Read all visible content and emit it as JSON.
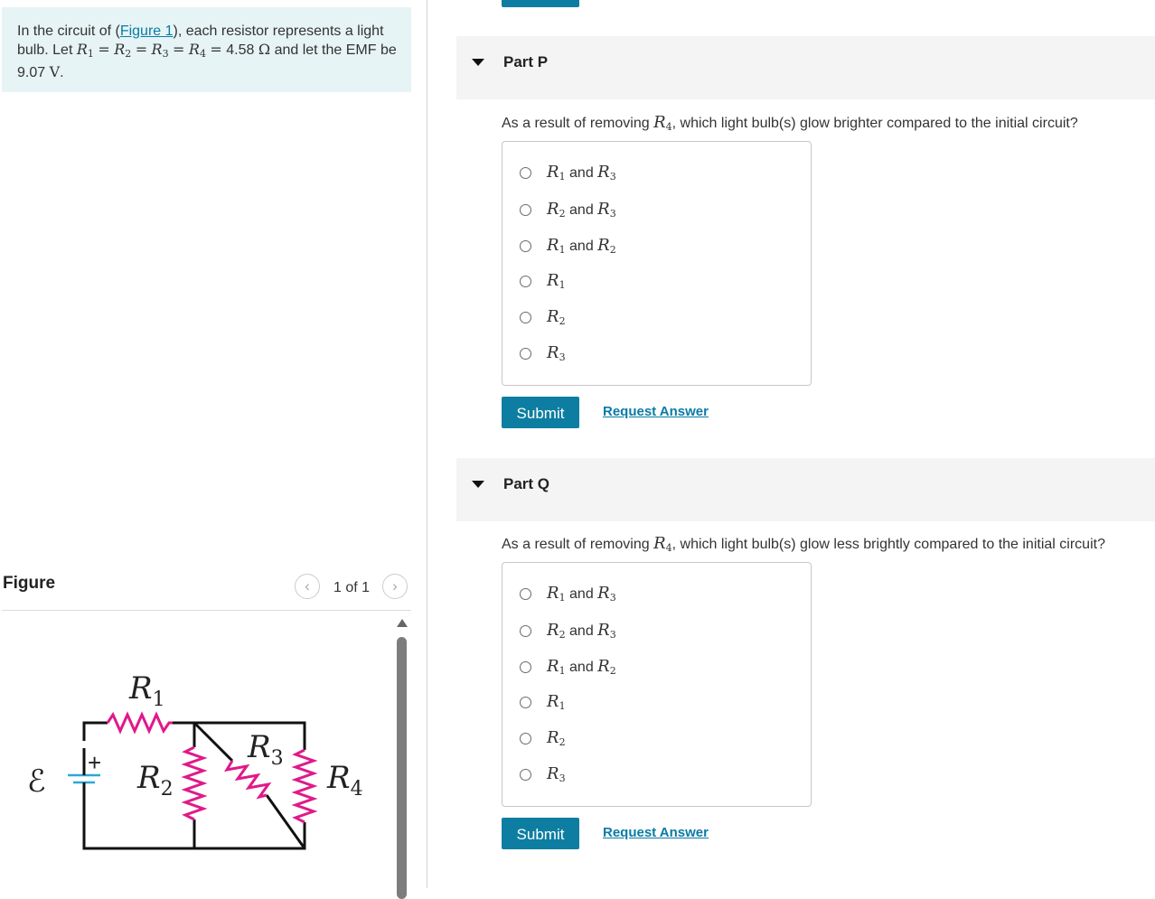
{
  "intro": {
    "p1": "In the circuit of (",
    "link": "Figure 1",
    "p2": "), each resistor represents a light bulb. Let ",
    "r1": "R",
    "r2": "R",
    "r3": "R",
    "r4": "R",
    "s1": "1",
    "s2": "2",
    "s3": "3",
    "s4": "4",
    "eq": "=",
    "value": "4.58",
    "ohm": "Ω",
    "p3": " and let the EMF be ",
    "emf": "9.07",
    "volt": "V",
    "p4": "."
  },
  "figure": {
    "title": "Figure",
    "pager": "1 of 1",
    "prev_icon": "chevron-left-icon",
    "next_icon": "chevron-right-icon",
    "labels": {
      "R": "R",
      "s1": "1",
      "s2": "2",
      "s3": "3",
      "s4": "4",
      "emf": "ℰ",
      "plus": "+"
    },
    "resistor_color": "#e0198a",
    "battery_color": "#2aa8d8"
  },
  "parts": [
    {
      "header": "Part P",
      "question_pre": "As a result of removing ",
      "question_var": "R",
      "question_sub": "4",
      "question_post": ", which light bulb(s) glow brighter compared to the initial circuit?",
      "choices": [
        {
          "a": "R",
          "as": "1",
          "and": "and",
          "b": "R",
          "bs": "3"
        },
        {
          "a": "R",
          "as": "2",
          "and": "and",
          "b": "R",
          "bs": "3"
        },
        {
          "a": "R",
          "as": "1",
          "and": "and",
          "b": "R",
          "bs": "2"
        },
        {
          "a": "R",
          "as": "1"
        },
        {
          "a": "R",
          "as": "2"
        },
        {
          "a": "R",
          "as": "3"
        }
      ],
      "submit": "Submit",
      "request": "Request Answer"
    },
    {
      "header": "Part Q",
      "question_pre": "As a result of removing ",
      "question_var": "R",
      "question_sub": "4",
      "question_post": ", which light bulb(s) glow less brightly compared to the initial circuit?",
      "choices": [
        {
          "a": "R",
          "as": "1",
          "and": "and",
          "b": "R",
          "bs": "3"
        },
        {
          "a": "R",
          "as": "2",
          "and": "and",
          "b": "R",
          "bs": "3"
        },
        {
          "a": "R",
          "as": "1",
          "and": "and",
          "b": "R",
          "bs": "2"
        },
        {
          "a": "R",
          "as": "1"
        },
        {
          "a": "R",
          "as": "2"
        },
        {
          "a": "R",
          "as": "3"
        }
      ],
      "submit": "Submit",
      "request": "Request Answer"
    }
  ],
  "colors": {
    "accent": "#0d7ea1",
    "link": "#0a7ba6",
    "intro_bg": "#e6f4f5",
    "header_bg": "#f4f4f4"
  }
}
